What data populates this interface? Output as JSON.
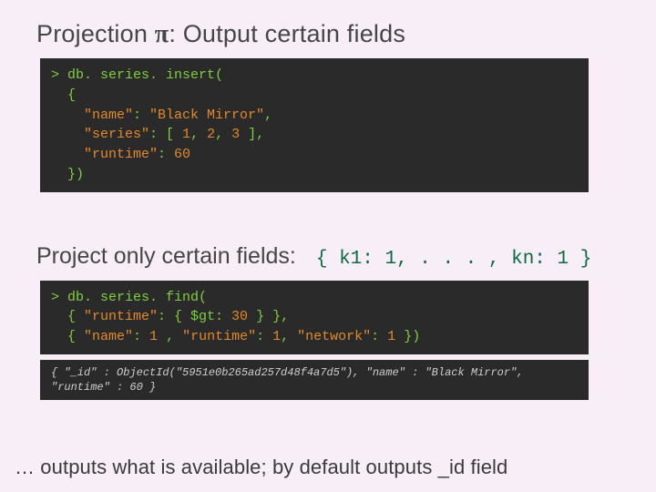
{
  "title": {
    "prefix": "Projection ",
    "pi": "π",
    "suffix": ": Output certain fields"
  },
  "code1": {
    "prompt": ">",
    "line1": "db. series. insert(",
    "line2": "  {",
    "line3a": "    \"name\"",
    "line3b": ": ",
    "line3c": "\"Black Mirror\"",
    "line3d": ",",
    "line4a": "    \"series\"",
    "line4b": ": [ ",
    "line4c": "1",
    "line4d": ", ",
    "line4e": "2",
    "line4f": ", ",
    "line4g": "3",
    "line4h": " ],",
    "line5a": "    \"runtime\"",
    "line5b": ": ",
    "line5c": "60",
    "line6": "  })"
  },
  "midrow": {
    "subhead": "Project only certain fields:",
    "signature": "{ k1: 1, . . . , kn: 1 }"
  },
  "code2": {
    "prompt": ">",
    "line1": "db. series. find(",
    "line2a": "  { ",
    "line2b": "\"runtime\"",
    "line2c": ": { $gt: ",
    "line2d": "30",
    "line2e": " } },",
    "line3a": "  { ",
    "line3b": "\"name\"",
    "line3c": ": ",
    "line3d": "1",
    "line3e": " , ",
    "line3f": "\"runtime\"",
    "line3g": ": ",
    "line3h": "1",
    "line3i": ", ",
    "line3j": "\"network\"",
    "line3k": ": ",
    "line3l": "1",
    "line3m": " })"
  },
  "out1": "{ \"_id\" : ObjectId(\"5951e0b265ad257d48f4a7d5\"), \"name\" : \"Black Mirror\", \"runtime\" : 60 }",
  "footnote": {
    "prefix": "… outputs what is available; by default outputs ",
    "id": "_id",
    "suffix": " field"
  }
}
